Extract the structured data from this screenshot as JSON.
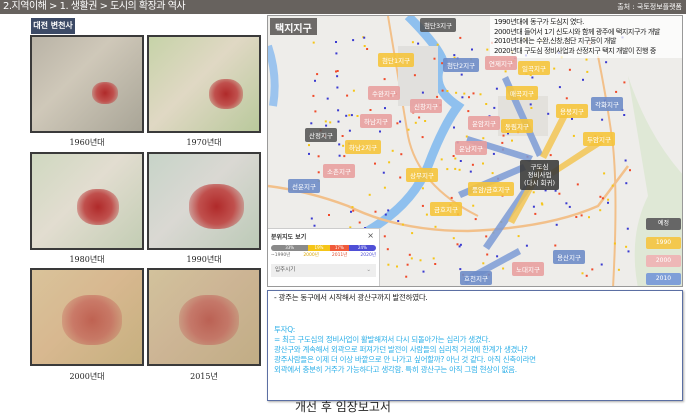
{
  "header": {
    "title": "2.지역이해 > 1. 생활권 > 도시의 확장과 역사",
    "source": "출처 : 국토정보플랫폼"
  },
  "history": {
    "label": "대전 변천사",
    "maps": [
      {
        "year": "1960년대"
      },
      {
        "year": "1970년대"
      },
      {
        "year": "1980년대"
      },
      {
        "year": "1990년대"
      },
      {
        "year": "2000년대"
      },
      {
        "year": "2015년"
      }
    ]
  },
  "map": {
    "title": "택지지구",
    "note": [
      "1990년대에 동구가 도심지 였다.",
      "2000년대 들어서 1기 신도시와 함께 광주에 택지지구가 개발",
      "2010년대에는 수완,신창,첨단 지구등이 개발",
      "2020년대 구도심 정비사업과 산정지구 택지 개발이 진행 중"
    ],
    "labels": [
      "첨단3지구",
      "첨단1지구",
      "첨단2지구",
      "수완지구",
      "신창지구",
      "하남지구",
      "산정지구",
      "하남2지구",
      "운남지구",
      "선운지구",
      "소촌지구",
      "연제지구",
      "일곡지구",
      "매곡지구",
      "운암지구",
      "동림지구",
      "용봉지구",
      "각화지구",
      "두암지구",
      "상무지구",
      "풍암/금호지구",
      "금호지구",
      "용산지구",
      "노대지구",
      "효천지구"
    ],
    "center_label": [
      "구도심",
      "정비사업",
      "(다시 회귀)"
    ],
    "legend": [
      "예정",
      "1990",
      "2000",
      "2010"
    ],
    "filter": {
      "title": "분위지도 보기",
      "close": "×",
      "segments": [
        "33%",
        "19%",
        "17%",
        "24%"
      ],
      "years": [
        "~1990년",
        "2000년",
        "2011년",
        "2020년"
      ],
      "select": "입주시기",
      "chevron": "⌄"
    },
    "colors": {
      "yellow": "#f5c43c",
      "pink": "#e8a0a0",
      "blue": "#6e8cc8",
      "gray": "#505050"
    }
  },
  "notes": {
    "summary": "-  광주는 동구에서 시작해서 광산구까지 발전하였다.",
    "investment_title": "투자Q:",
    "investment_lines": [
      "= 최근 구도심의 정비사업이 활발해져서 다시 되돌아가는 심리가 생겼다.",
      "광산구와 계속해서 외곽으로 퍼져가던 발전이 사람들의 심리적 거리에 한계가 생겼나?",
      "광주사람들은 이제 더 이상 바깥으로 안 나가고 싶어할까? 아닌 것 같다. 아직 신축이라면",
      "외곽에서 충분히 거주가 가능하다고 생각함. 특히 광산구는 아직 그럼 현상이 없음."
    ]
  },
  "footer": "개선 후 임장보고서"
}
